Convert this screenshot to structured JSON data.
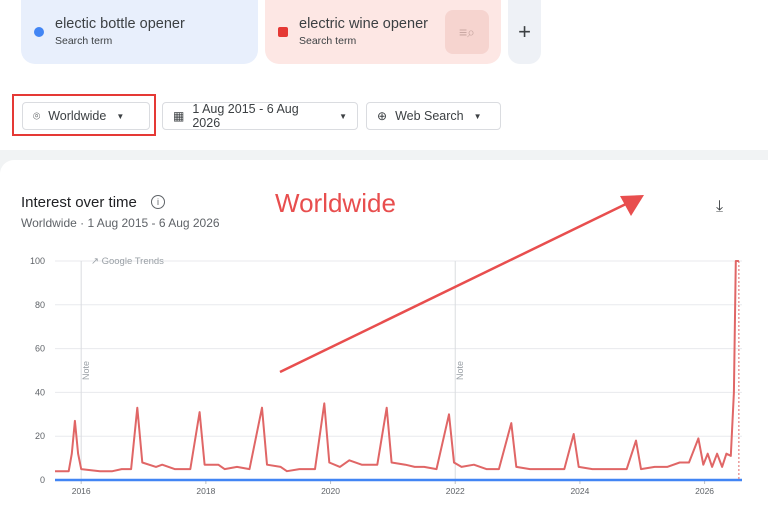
{
  "terms": [
    {
      "name": "electic bottle opener",
      "sub": "Search term",
      "color": "#4285f4"
    },
    {
      "name": "electric wine opener",
      "sub": "Search term",
      "color": "#e53935"
    }
  ],
  "add_label": "+",
  "filters": {
    "location": "Worldwide",
    "date_range": "1 Aug 2015 - 6 Aug 2026",
    "search_type": "Web Search"
  },
  "chart_section": {
    "title": "Interest over time",
    "subtitle": "Worldwide · 1 Aug 2015 - 6 Aug 2026",
    "annotation": "Worldwide",
    "watermark": "Google Trends",
    "note_label": "Note"
  },
  "chart_data": {
    "type": "line",
    "ylim": [
      0,
      100
    ],
    "yticks": [
      "0",
      "20",
      "40",
      "60",
      "80",
      "100"
    ],
    "xticks": [
      {
        "label": "2016",
        "x": 2016.0
      },
      {
        "label": "2018",
        "x": 2018.0
      },
      {
        "label": "2020",
        "x": 2020.0
      },
      {
        "label": "2022",
        "x": 2022.0
      },
      {
        "label": "2024",
        "x": 2024.0
      },
      {
        "label": "2026",
        "x": 2026.0
      }
    ],
    "xlim": [
      2015.58,
      2026.6
    ],
    "notes_x": [
      2016.0,
      2022.0
    ],
    "series": [
      {
        "name": "electric wine opener",
        "color": "#e06666",
        "points": [
          [
            2015.58,
            4
          ],
          [
            2015.8,
            4
          ],
          [
            2015.85,
            12
          ],
          [
            2015.9,
            27
          ],
          [
            2015.95,
            12
          ],
          [
            2016.0,
            5
          ],
          [
            2016.3,
            4
          ],
          [
            2016.5,
            4
          ],
          [
            2016.65,
            5
          ],
          [
            2016.8,
            5
          ],
          [
            2016.9,
            33
          ],
          [
            2016.98,
            8
          ],
          [
            2017.2,
            6
          ],
          [
            2017.3,
            7
          ],
          [
            2017.5,
            5
          ],
          [
            2017.75,
            5
          ],
          [
            2017.9,
            31
          ],
          [
            2017.98,
            7
          ],
          [
            2018.2,
            7
          ],
          [
            2018.3,
            5
          ],
          [
            2018.5,
            6
          ],
          [
            2018.7,
            5
          ],
          [
            2018.9,
            33
          ],
          [
            2018.98,
            7
          ],
          [
            2019.2,
            6
          ],
          [
            2019.3,
            4
          ],
          [
            2019.5,
            5
          ],
          [
            2019.75,
            5
          ],
          [
            2019.9,
            35
          ],
          [
            2019.98,
            8
          ],
          [
            2020.15,
            6
          ],
          [
            2020.3,
            9
          ],
          [
            2020.5,
            7
          ],
          [
            2020.75,
            7
          ],
          [
            2020.9,
            33
          ],
          [
            2020.98,
            8
          ],
          [
            2021.2,
            7
          ],
          [
            2021.35,
            6
          ],
          [
            2021.5,
            6
          ],
          [
            2021.7,
            5
          ],
          [
            2021.9,
            30
          ],
          [
            2021.98,
            8
          ],
          [
            2022.1,
            6
          ],
          [
            2022.3,
            7
          ],
          [
            2022.5,
            5
          ],
          [
            2022.7,
            5
          ],
          [
            2022.9,
            26
          ],
          [
            2022.98,
            6
          ],
          [
            2023.2,
            5
          ],
          [
            2023.4,
            5
          ],
          [
            2023.6,
            5
          ],
          [
            2023.75,
            5
          ],
          [
            2023.9,
            21
          ],
          [
            2023.98,
            6
          ],
          [
            2024.2,
            5
          ],
          [
            2024.4,
            5
          ],
          [
            2024.6,
            5
          ],
          [
            2024.75,
            5
          ],
          [
            2024.9,
            18
          ],
          [
            2024.98,
            5
          ],
          [
            2025.2,
            6
          ],
          [
            2025.4,
            6
          ],
          [
            2025.6,
            8
          ],
          [
            2025.75,
            8
          ],
          [
            2025.9,
            19
          ],
          [
            2025.98,
            7
          ],
          [
            2026.05,
            12
          ],
          [
            2026.12,
            6
          ],
          [
            2026.2,
            12
          ],
          [
            2026.28,
            6
          ],
          [
            2026.35,
            12
          ],
          [
            2026.42,
            11
          ],
          [
            2026.47,
            40
          ],
          [
            2026.5,
            100
          ],
          [
            2026.55,
            100
          ]
        ]
      },
      {
        "name": "electic bottle opener",
        "color": "#4285f4",
        "points": [
          [
            2015.58,
            0
          ],
          [
            2026.6,
            0
          ]
        ]
      }
    ]
  }
}
